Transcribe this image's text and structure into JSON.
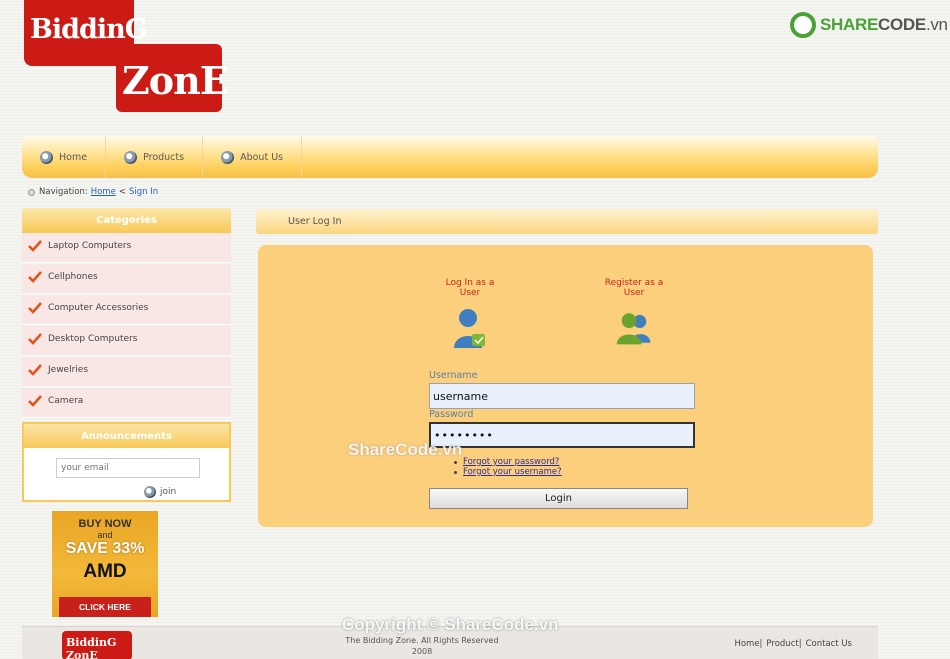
{
  "logo": {
    "line1": "BiddinG",
    "line2": "ZonE"
  },
  "brand": {
    "share": "SHARE",
    "code": "CODE",
    "tld": ".vn"
  },
  "nav": {
    "items": [
      {
        "label": "Home",
        "icon": "globe-icon"
      },
      {
        "label": "Products",
        "icon": "globe-icon"
      },
      {
        "label": "About Us",
        "icon": "globe-icon"
      }
    ]
  },
  "breadcrumb": {
    "prefix": "Navigation:",
    "home": "Home",
    "separator": "<",
    "current": "Sign In"
  },
  "sidebar": {
    "categories_title": "Categories",
    "categories": [
      "Laptop Computers",
      "Cellphones",
      "Computer Accessories",
      "Desktop Computers",
      "Jewelries",
      "Camera"
    ],
    "announcements_title": "Announcements",
    "email_placeholder": "your email",
    "join_label": "join"
  },
  "ad": {
    "buy": "BUY NOW",
    "and": "and",
    "save": "SAVE 33%",
    "brand": "AMD",
    "cta": "CLICK HERE"
  },
  "main": {
    "title": "User Log In",
    "login_option": "Log In as a User",
    "register_option": "Register as a User",
    "username_label": "Username",
    "username_value": "username",
    "password_label": "Password",
    "password_value": "••••••••",
    "forgot_password": "Forgot your password?",
    "forgot_username": "Forgot your username?",
    "login_button": "Login"
  },
  "watermarks": {
    "mid": "ShareCode.vn",
    "bottom": "Copyright © ShareCode.vn"
  },
  "footer": {
    "logo_text": "BiddinG ZonE",
    "copyright_line1": "The Bidding Zone. All Rights Reserved",
    "copyright_line2": "2008",
    "links": [
      "Home|",
      "Product|",
      "Contact Us"
    ]
  },
  "colors": {
    "accent": "#f8c957",
    "brand_red": "#cc1a14",
    "link": "#2a62b8",
    "panel": "#fccf7d"
  }
}
